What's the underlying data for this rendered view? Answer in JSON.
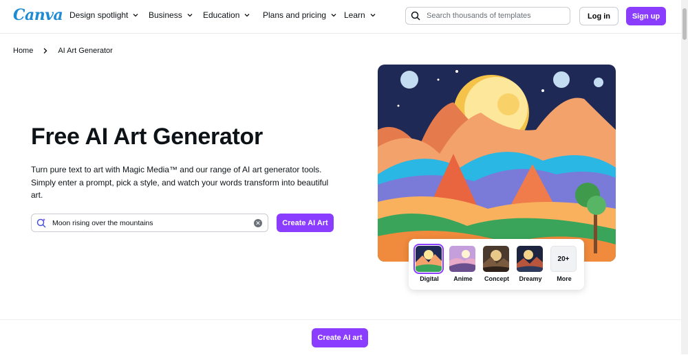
{
  "header": {
    "logo": "Canva",
    "nav": [
      {
        "label": "Design spotlight"
      },
      {
        "label": "Business"
      },
      {
        "label": "Education"
      },
      {
        "label": "Plans and pricing"
      },
      {
        "label": "Learn"
      }
    ],
    "search_placeholder": "Search thousands of templates",
    "login_label": "Log in",
    "signup_label": "Sign up"
  },
  "breadcrumb": {
    "home": "Home",
    "current": "AI Art Generator"
  },
  "hero": {
    "title": "Free AI Art Generator",
    "description": "Turn pure text to art with Magic Media™ and our range of AI art generator tools. Simply enter a prompt, pick a style, and watch your words transform into beautiful art.",
    "prompt_value": "Moon rising over the mountains",
    "create_label": "Create AI Art"
  },
  "styles": [
    {
      "label": "Digital",
      "selected": true
    },
    {
      "label": "Anime",
      "selected": false
    },
    {
      "label": "Concept",
      "selected": false
    },
    {
      "label": "Dreamy",
      "selected": false
    },
    {
      "label": "More",
      "badge": "20+",
      "selected": false
    }
  ],
  "bottom_bar": {
    "create_label": "Create AI art"
  },
  "colors": {
    "accent": "#8b3dff",
    "logo": "#1f8bd3"
  }
}
